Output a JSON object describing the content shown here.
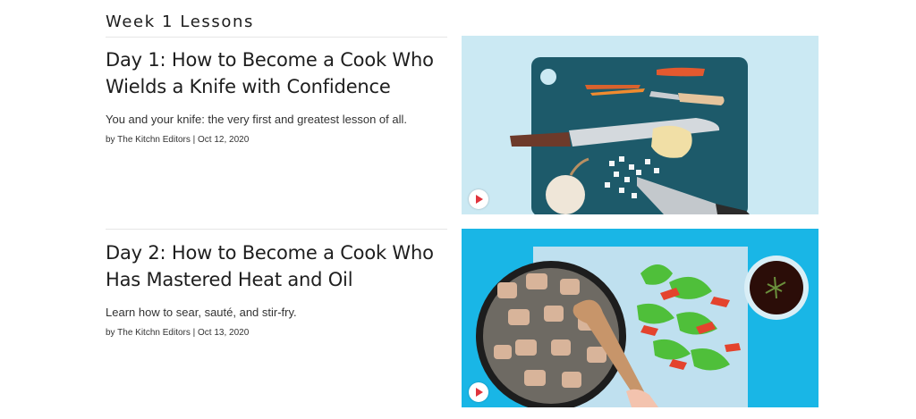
{
  "section": {
    "title": "Week 1 Lessons"
  },
  "lessons": [
    {
      "title_line1": "Day 1: How to Become a Cook Who",
      "title_line2": "Wields a Knife with Confidence",
      "description": "You and your knife: the very first and greatest lesson of all.",
      "meta": "by The Kitchn Editors | Oct 12, 2020"
    },
    {
      "title_line1": "Day 2: How to Become a Cook Who",
      "title_line2": "Has Mastered Heat and Oil",
      "description": "Learn how to sear, sauté, and stir-fry.",
      "meta": "by The Kitchn Editors | Oct 13, 2020"
    }
  ],
  "icons": {
    "play": "play-icon"
  },
  "colors": {
    "background": "#ffffff",
    "text": "#1e1e1e",
    "play_accent": "#e0333c",
    "thumb1_bg": "#cbe9f3",
    "thumb2_bg": "#19b6e6"
  }
}
